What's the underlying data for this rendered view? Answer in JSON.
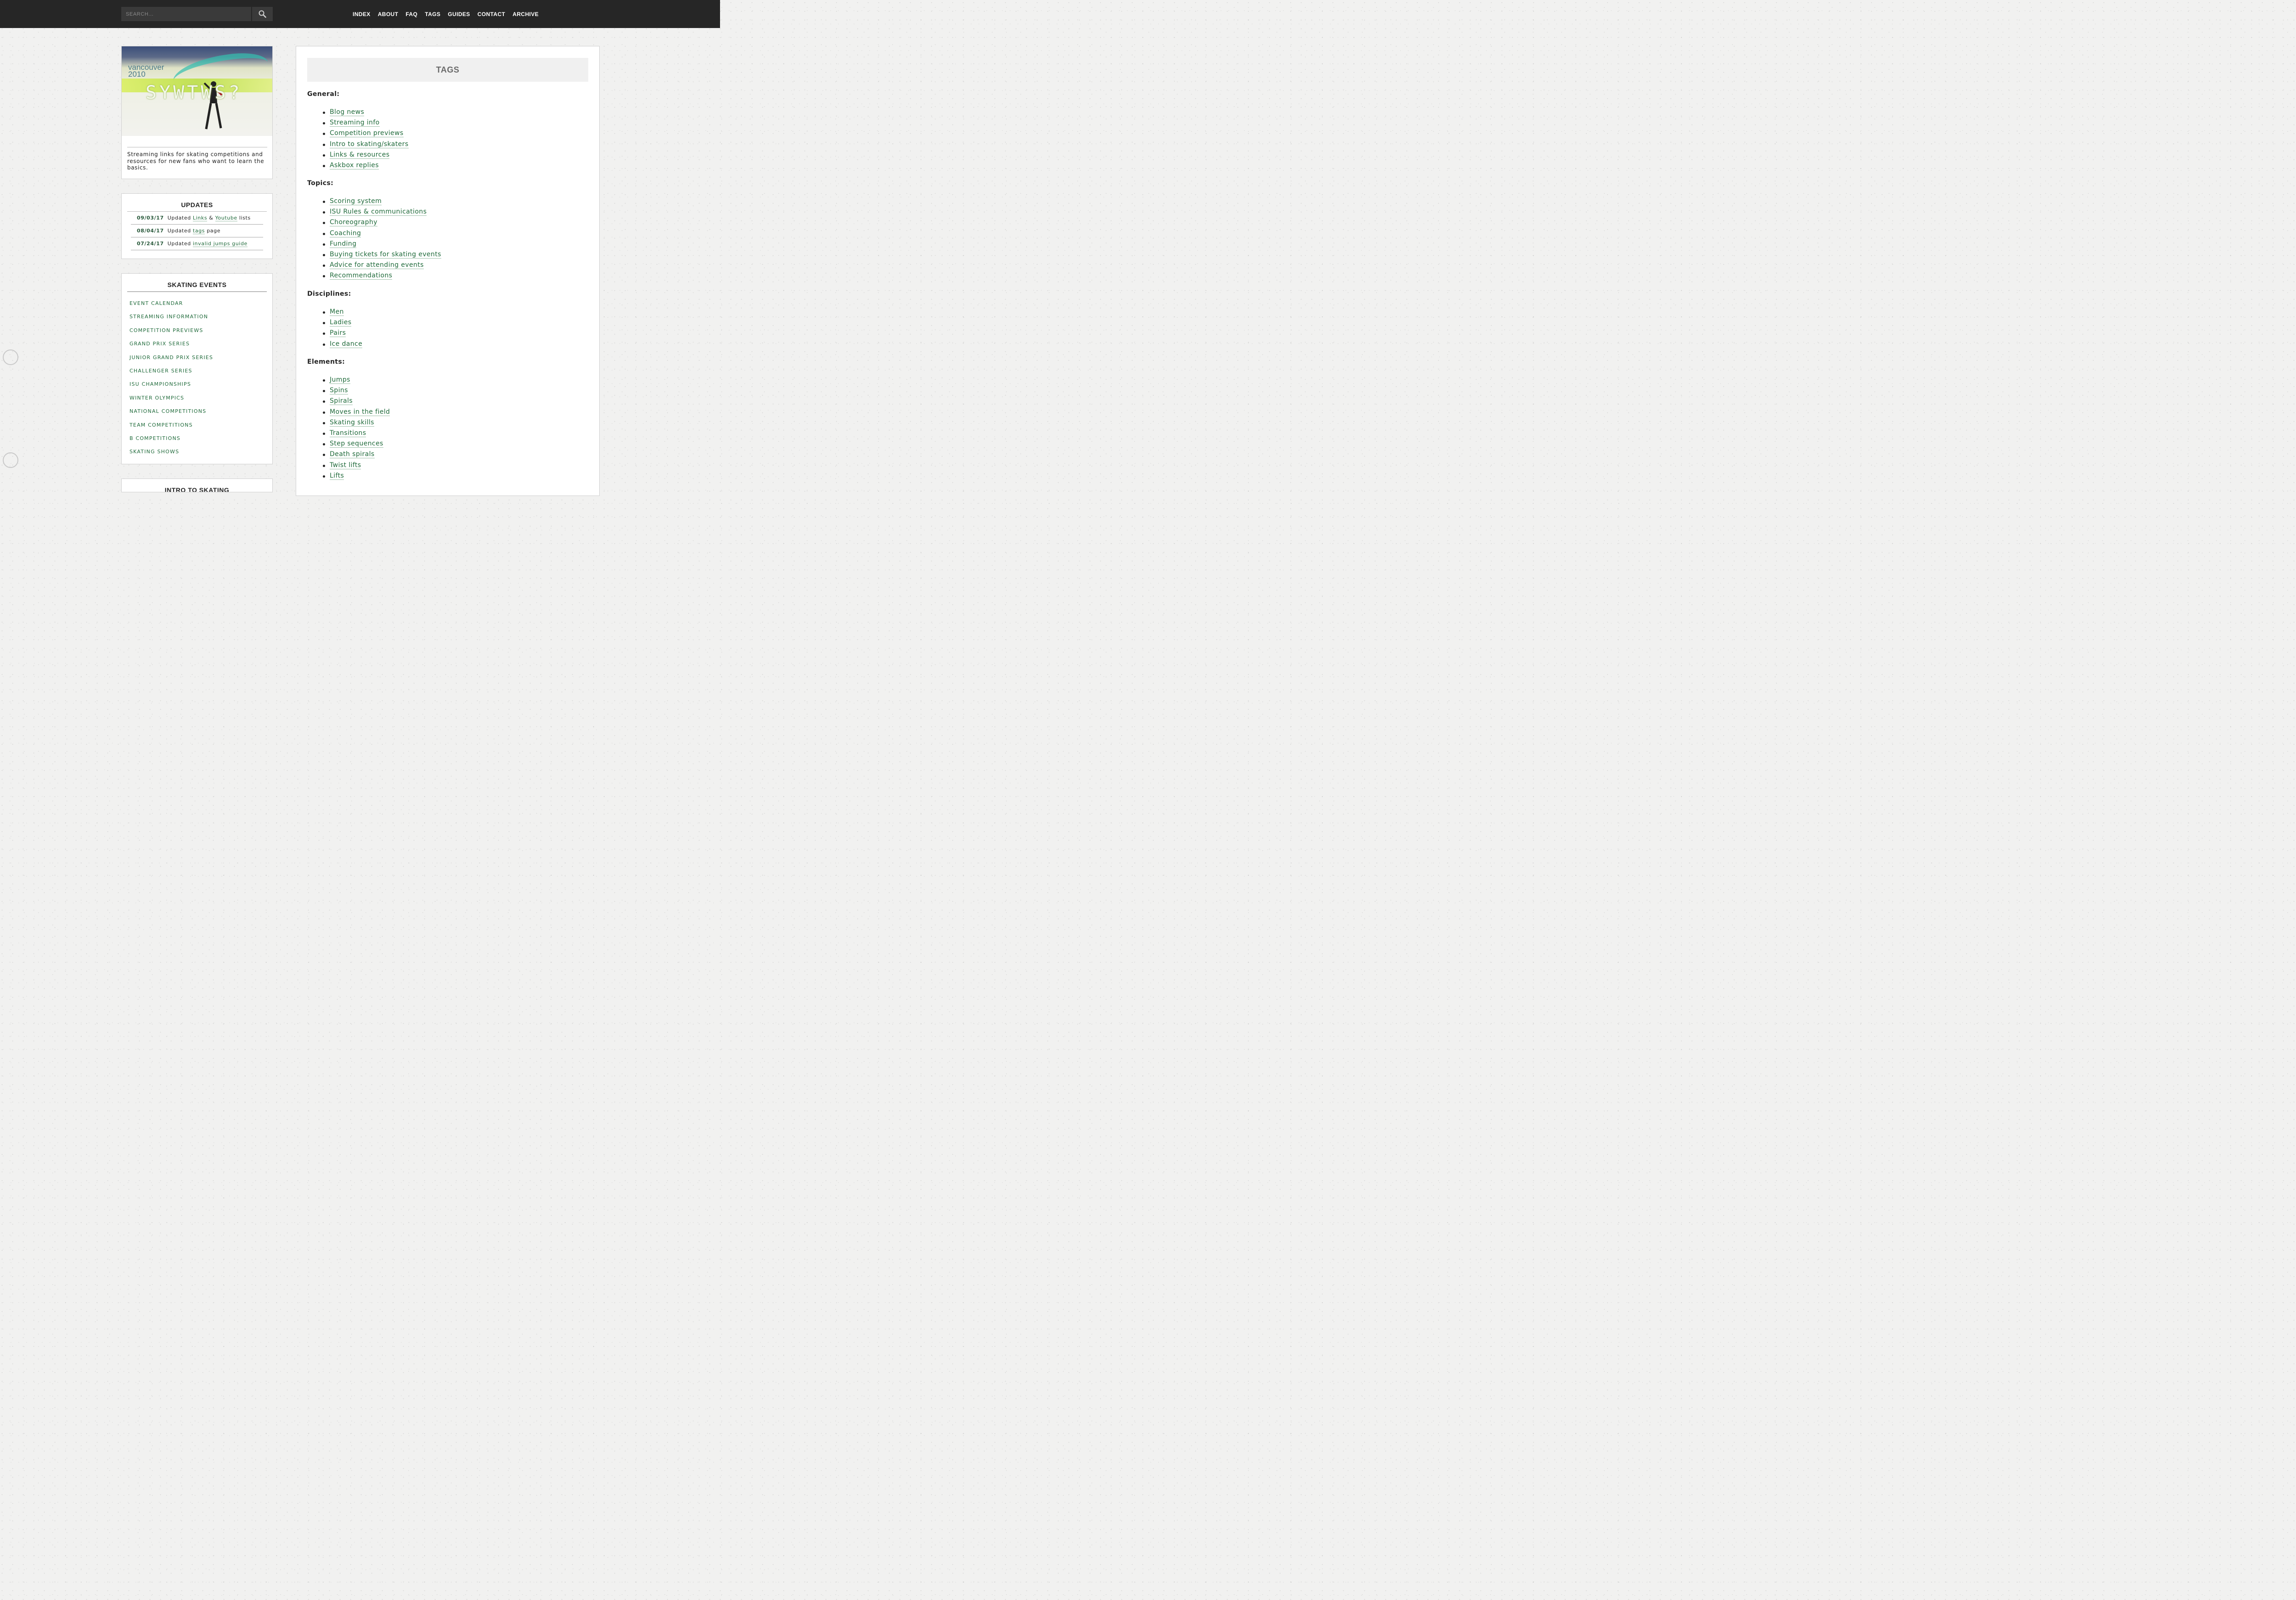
{
  "topbar": {
    "search_placeholder": "SEARCH...",
    "search_icon": "search-icon",
    "nav": [
      "INDEX",
      "ABOUT",
      "FAQ",
      "TAGS",
      "GUIDES",
      "CONTACT",
      "ARCHIVE"
    ]
  },
  "header": {
    "image_logo": "vancouver 2010",
    "image_overlay": "SYWTWS?",
    "description": "Streaming links for skating competitions and resources for new fans who want to learn the basics."
  },
  "updates": {
    "title": "UPDATES",
    "rows": [
      {
        "date": "09/03/17",
        "pre": "Updated",
        "link1": "Links",
        "mid": "&",
        "link2": "Youtube",
        "post": "lists"
      },
      {
        "date": "08/04/17",
        "pre": "Updated",
        "link1": "tags",
        "post": "page"
      },
      {
        "date": "07/24/17",
        "pre": "Updated",
        "link1": "invalid jumps guide"
      }
    ]
  },
  "events": {
    "title": "SKATING EVENTS",
    "items": [
      "EVENT CALENDAR",
      "STREAMING INFORMATION",
      "COMPETITION PREVIEWS",
      "GRAND PRIX SERIES",
      "JUNIOR GRAND PRIX SERIES",
      "CHALLENGER SERIES",
      "ISU CHAMPIONSHIPS",
      "WINTER OLYMPICS",
      "NATIONAL COMPETITIONS",
      "TEAM COMPETITIONS",
      "B COMPETITIONS",
      "SKATING SHOWS"
    ]
  },
  "next_box_title": "INTRO TO SKATING",
  "main": {
    "title": "TAGS",
    "sections": [
      {
        "heading": "General:",
        "items": [
          "Blog news",
          "Streaming info",
          "Competition previews",
          "Intro to skating/skaters",
          "Links & resources",
          "Askbox replies"
        ]
      },
      {
        "heading": "Topics:",
        "items": [
          "Scoring system",
          "ISU Rules & communications",
          "Choreography",
          "Coaching",
          "Funding",
          "Buying tickets for skating events",
          "Advice for attending events",
          "Recommendations"
        ]
      },
      {
        "heading": "Disciplines:",
        "items": [
          "Men",
          "Ladies",
          "Pairs",
          "Ice dance"
        ]
      },
      {
        "heading": "Elements:",
        "items": [
          "Jumps",
          "Spins",
          "Spirals",
          "Moves in the field",
          "Skating skills",
          "Transitions",
          "Step sequences",
          "Death spirals",
          "Twist lifts",
          "Lifts"
        ]
      }
    ]
  }
}
